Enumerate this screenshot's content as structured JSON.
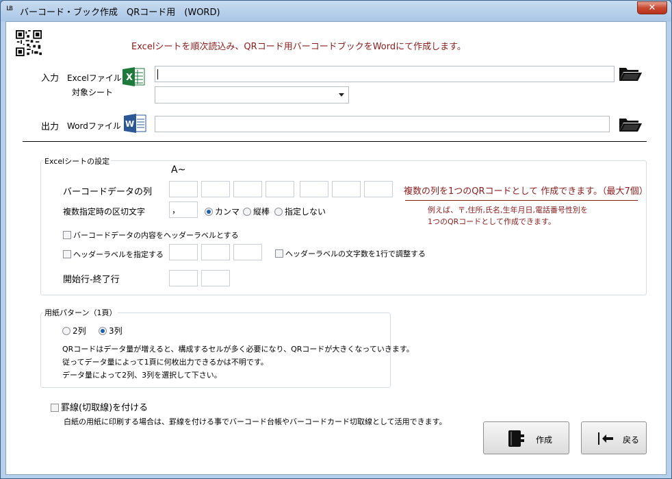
{
  "window": {
    "icon_text": "LB",
    "title": "バーコード・ブック作成　QRコード用　(WORD)",
    "close_symbol": "✕"
  },
  "header": {
    "message": "Excelシートを順次読込み、QRコード用バーコードブックをWordにて作成します。"
  },
  "input": {
    "section_label": "入力",
    "excel_file_label": "Excelファイル",
    "excel_file_value": "",
    "sheet_label": "対象シート",
    "sheet_value": ""
  },
  "output": {
    "section_label": "出力",
    "word_file_label": "Wordファイル",
    "word_file_value": ""
  },
  "excel_settings": {
    "title": "Excelシートの設定",
    "column_start_label": "A~",
    "barcode_column_label": "バーコードデータの列",
    "barcode_columns": [
      "",
      "",
      "",
      "",
      "",
      "",
      ""
    ],
    "delimiter_label": "複数指定時の区切文字",
    "delimiter_value": "，",
    "delimiter_options": [
      "カンマ",
      "縦棒",
      "指定しない"
    ],
    "delimiter_selected": "カンマ",
    "multi_note": "複数の列を1つのQRコードとして 作成できます。（最大7個）",
    "example_line1": "例えば、〒,住所,氏名,生年月日,電話番号性別を",
    "example_line2": "1つのQRコードとして作成できます。",
    "header_label_from_content": "バーコードデータの内容をヘッダーラベルとする",
    "header_label_specify": "ヘッダーラベルを指定する",
    "header_labels": [
      "",
      "",
      ""
    ],
    "header_label_fit": "ヘッダーラベルの文字数を1行で調整する",
    "start_end_row_label": "開始行-終了行",
    "start_row": "",
    "end_row": ""
  },
  "paper": {
    "title": "用紙パターン（1頁）",
    "options": [
      "2列",
      "3列"
    ],
    "selected": "3列",
    "note_line1": "QRコードはデータ量が増えると、構成するセルが多く必要になり、QRコードが大きくなっていきます。",
    "note_line2": "従ってデータ量によって1頁に何枚出力できるかは不明です。",
    "note_line3": "データ量によって2列、3列を選択して下さい。"
  },
  "ruled": {
    "label": "罫線(切取線)を付ける",
    "note": "白紙の用紙に印刷する場合は、罫線を付ける事でバーコード台帳やバーコードカード切取線として活用できます。"
  },
  "actions": {
    "create_label": "作成",
    "back_label": "戻る"
  },
  "colors": {
    "accent_red": "#8b1a1a",
    "excel_green": "#1d7a3a",
    "word_blue": "#2b5797"
  }
}
